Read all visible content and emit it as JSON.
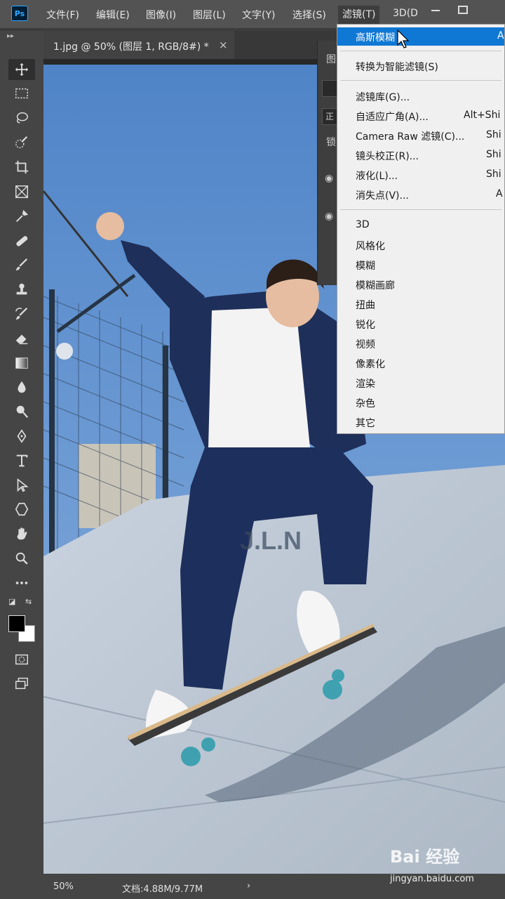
{
  "app": {
    "logo": "Ps"
  },
  "menubar": {
    "items": [
      "文件(F)",
      "编辑(E)",
      "图像(I)",
      "图层(L)",
      "文字(Y)",
      "选择(S)",
      "滤镜(T)",
      "3D(D"
    ],
    "active": "滤镜(T)"
  },
  "document_tab": {
    "title": "1.jpg @ 50% (图层 1, RGB/8#) *",
    "close": "×"
  },
  "layers_panel_peek": {
    "title": "图",
    "mode": "正",
    "lock": "锁"
  },
  "filter_menu": {
    "top_items": [
      {
        "label": "高斯模糊",
        "shortcut": "A",
        "highlighted": true
      },
      {
        "label": "转换为智能滤镜(S)",
        "shortcut": ""
      }
    ],
    "mid_items": [
      {
        "label": "滤镜库(G)...",
        "shortcut": ""
      },
      {
        "label": "自适应广角(A)...",
        "shortcut": "Alt+Shi"
      },
      {
        "label": "Camera Raw 滤镜(C)...",
        "shortcut": "Shi"
      },
      {
        "label": "镜头校正(R)...",
        "shortcut": "Shi"
      },
      {
        "label": "液化(L)...",
        "shortcut": "Shi"
      },
      {
        "label": "消失点(V)...",
        "shortcut": "A"
      }
    ],
    "sub_items": [
      "3D",
      "风格化",
      "模糊",
      "模糊画廊",
      "扭曲",
      "锐化",
      "视频",
      "像素化",
      "渲染",
      "杂色",
      "其它"
    ]
  },
  "statusbar": {
    "zoom": "50%",
    "doc": "文档:4.88M/9.77M",
    "arrow": "›"
  },
  "watermark": {
    "logo": "Bai 经验",
    "url": "jingyan.baidu.com"
  },
  "colors": {
    "highlight": "#0f78d4",
    "ps_blue": "#31a8ff",
    "chrome": "#535353"
  },
  "tools": [
    "move-icon",
    "marquee-icon",
    "lasso-icon",
    "quick-select-icon",
    "crop-icon",
    "frame-icon",
    "eyedropper-icon",
    "healing-icon",
    "brush-icon",
    "stamp-icon",
    "history-brush-icon",
    "eraser-icon",
    "gradient-icon",
    "blur-icon",
    "dodge-icon",
    "pen-icon",
    "type-icon",
    "path-select-icon",
    "shape-icon",
    "hand-icon",
    "zoom-icon",
    "more-icon"
  ]
}
